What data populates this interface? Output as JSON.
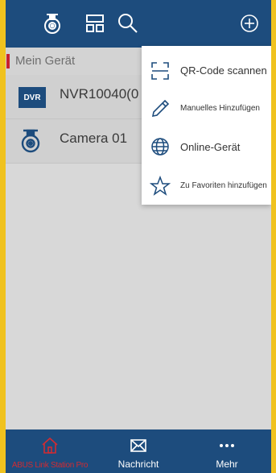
{
  "topbar": {
    "icons": [
      "camera-icon",
      "layout-icon",
      "search-icon",
      "add-icon"
    ]
  },
  "list": {
    "section_label": "Mein Gerät",
    "devices": [
      {
        "badge": "DVR",
        "name": "NVR10040(0",
        "icon": "dvr-badge"
      },
      {
        "name": "Camera 01",
        "icon": "camera-icon"
      }
    ]
  },
  "menu": {
    "items": [
      {
        "label": "QR-Code scannen",
        "icon": "qr-scan-icon"
      },
      {
        "label": "Manuelles Hinzufügen",
        "icon": "pencil-icon"
      },
      {
        "label": "Online-Gerät",
        "icon": "globe-icon"
      },
      {
        "label": "Zu Favoriten hinzufügen",
        "icon": "star-icon"
      }
    ]
  },
  "bottomnav": {
    "items": [
      {
        "label": "ABUS Link Station Pro",
        "icon": "home-icon",
        "active": true
      },
      {
        "label": "Nachricht",
        "icon": "message-icon",
        "active": false
      },
      {
        "label": "Mehr",
        "icon": "more-icon",
        "active": false
      }
    ]
  },
  "colors": {
    "brand_blue": "#1d4c7d",
    "accent_red": "#c8202e",
    "frame_yellow": "#f0c21e"
  }
}
